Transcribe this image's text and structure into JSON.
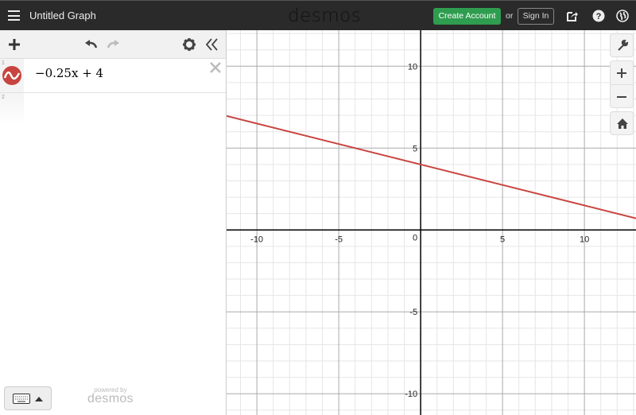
{
  "header": {
    "title": "Untitled Graph",
    "brand": "desmos",
    "create_account_label": "Create Account",
    "or_label": "or",
    "sign_in_label": "Sign In",
    "icons": [
      "share-icon",
      "help-icon",
      "language-globe-icon"
    ]
  },
  "expression_panel": {
    "toolbar_icons": [
      "add-icon",
      "undo-icon",
      "redo-icon",
      "settings-gear-icon",
      "collapse-panel-icon"
    ],
    "expressions": [
      {
        "index": "1",
        "latex": "−0.25x + 4",
        "color": "#c74440",
        "icon": "graph-wave-icon"
      },
      {
        "index": "2",
        "latex": ""
      }
    ],
    "keyboard_button": "keyboard-icon",
    "powered_by_small": "powered by",
    "powered_by_brand": "desmos"
  },
  "graph_controls": [
    "wrench-icon",
    "zoom-in-icon",
    "zoom-out-icon",
    "home-icon"
  ],
  "graph": {
    "function": {
      "slope": -0.25,
      "intercept": 4,
      "color": "#c74440"
    },
    "x_range": [
      -11.85,
      13.15
    ],
    "y_range": [
      -11.3,
      12.2
    ],
    "major_step": 5,
    "minor_step": 1,
    "x_tick_labels": [
      "-10",
      "-5",
      "0",
      "5",
      "10"
    ],
    "y_tick_labels": [
      "10",
      "5",
      "-5",
      "-10"
    ],
    "axis_color": "#000000",
    "major_grid_color": "#aaaaaa",
    "minor_grid_color": "#e6e6e6"
  }
}
